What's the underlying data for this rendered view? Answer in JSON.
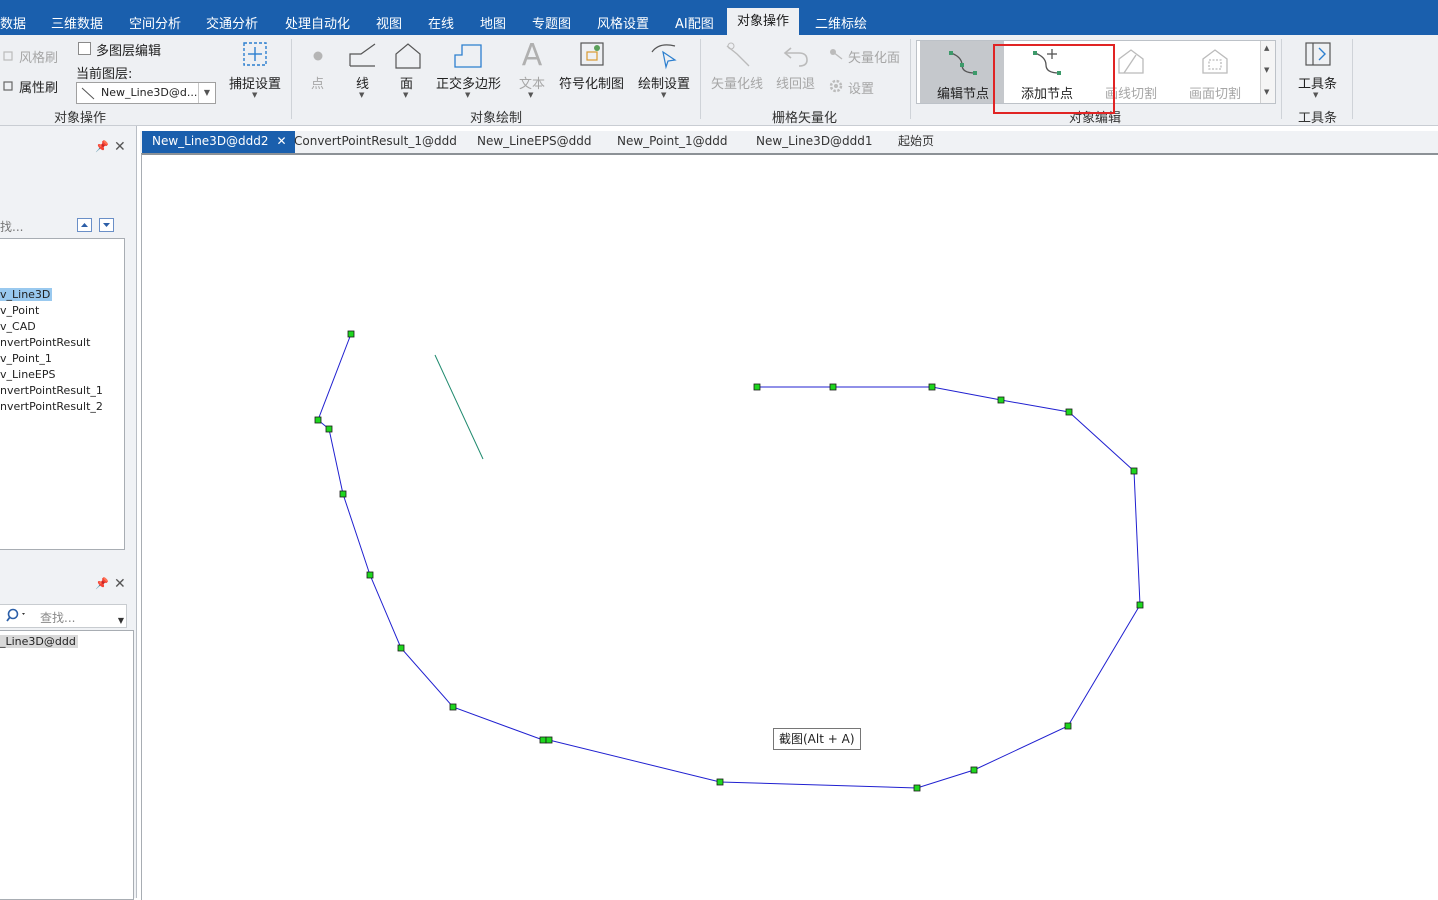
{
  "menubar": {
    "items": [
      {
        "label": "数据"
      },
      {
        "label": "三维数据"
      },
      {
        "label": "空间分析"
      },
      {
        "label": "交通分析"
      },
      {
        "label": "处理自动化"
      },
      {
        "label": "视图"
      },
      {
        "label": "在线"
      },
      {
        "label": "地图"
      },
      {
        "label": "专题图"
      },
      {
        "label": "风格设置"
      },
      {
        "label": "AI配图"
      },
      {
        "label": "对象操作"
      },
      {
        "label": "二维标绘"
      }
    ],
    "active_index": 11
  },
  "ribbon": {
    "object_ops": {
      "style_brush": "风格刷",
      "attr_brush": "属性刷",
      "multi_layer_edit": "多图层编辑",
      "multi_layer_checked": false,
      "current_layer_label": "当前图层:",
      "current_layer_value": "New_Line3D@d...",
      "snap_settings": "捕捉设置",
      "group_label": "对象操作"
    },
    "draw": {
      "point": "点",
      "line": "线",
      "polygon": "面",
      "ortho_polygon": "正交多边形",
      "text": "文本",
      "symbol_draw": "符号化制图",
      "draw_settings": "绘制设置",
      "group_label": "对象绘制"
    },
    "raster": {
      "vectorize_line": "矢量化线",
      "line_undo": "线回退",
      "vectorize_polygon": "矢量化面",
      "settings": "设置",
      "group_label": "栅格矢量化"
    },
    "edit": {
      "edit_node": "编辑节点",
      "add_node": "添加节点",
      "cut_by_line": "画线切割",
      "cut_by_polygon": "画面切割",
      "group_label": "对象编辑"
    },
    "toolbar": {
      "toolbar_btn": "工具条",
      "group_label": "工具条"
    }
  },
  "left_pane": {
    "search_placeholder": "找...",
    "layers": [
      "v_Line3D",
      "v_Point",
      "v_CAD",
      "nvertPointResult",
      "v_Point_1",
      "v_LineEPS",
      "nvertPointResult_1",
      "nvertPointResult_2"
    ],
    "selected_layer_index": 0,
    "lower_search_placeholder": "查找...",
    "lower_item": "_Line3D@ddd"
  },
  "tabs": [
    {
      "label": "New_Line3D@ddd2",
      "active": true
    },
    {
      "label": "ConvertPointResult_1@ddd",
      "active": false
    },
    {
      "label": "New_LineEPS@ddd",
      "active": false
    },
    {
      "label": "New_Point_1@ddd",
      "active": false
    },
    {
      "label": "New_Line3D@ddd1",
      "active": false
    },
    {
      "label": "起始页",
      "active": false
    }
  ],
  "tooltip": "截图(Alt + A)",
  "colors": {
    "brand_blue": "#1a5fad",
    "line_blue": "#2020d0",
    "node_green": "#1ed71e",
    "line_teal": "#1f8a6e",
    "highlight_red": "#e02424"
  }
}
